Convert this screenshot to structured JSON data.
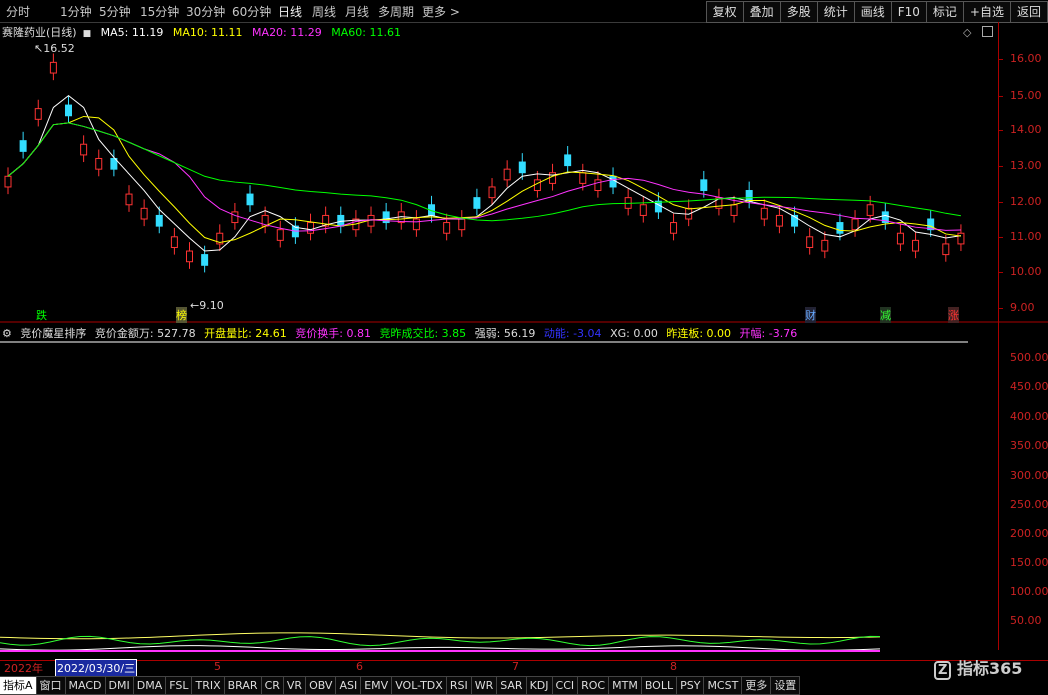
{
  "timeframes": [
    {
      "label": "分时",
      "active": false
    },
    {
      "label": "1分钟",
      "active": false
    },
    {
      "label": "5分钟",
      "active": false
    },
    {
      "label": "15分钟",
      "active": false
    },
    {
      "label": "30分钟",
      "active": false
    },
    {
      "label": "60分钟",
      "active": false
    },
    {
      "label": "日线",
      "active": true
    },
    {
      "label": "周线",
      "active": false
    },
    {
      "label": "月线",
      "active": false
    },
    {
      "label": "多周期",
      "active": false
    },
    {
      "label": "更多 >",
      "active": false
    }
  ],
  "toolbar": [
    "复权",
    "叠加",
    "多股",
    "统计",
    "画线",
    "F10",
    "标记",
    "+自选",
    "返回"
  ],
  "header": {
    "stock": "赛隆药业(日线)",
    "ma5": "MA5: 11.19",
    "ma10": "MA10: 11.11",
    "ma20": "MA20: 11.29",
    "ma60": "MA60: 11.61",
    "high_label": "16.52",
    "low_label": "9.10"
  },
  "colors": {
    "ma5": "#ffffff",
    "ma10": "#ffff00",
    "ma20": "#ff33ff",
    "ma60": "#00ff00",
    "up": "#ff3333",
    "down": "#33ddff",
    "axis": "#cc2222"
  },
  "price_axis": [
    "16.00",
    "15.00",
    "14.00",
    "13.00",
    "12.00",
    "11.00",
    "10.00",
    "9.00"
  ],
  "ind_axis": [
    "500.00",
    "450.00",
    "400.00",
    "350.00",
    "300.00",
    "250.00",
    "200.00",
    "150.00",
    "100.00",
    "50.00"
  ],
  "markers": {
    "die": "跌",
    "bang": "榜",
    "cai": "财",
    "jian": "减",
    "zhang": "涨"
  },
  "indicator": {
    "name": "竞价魔星排序",
    "amount_label": "竞价金额万: 527.78",
    "open_ratio": "开盘量比: 24.61",
    "turnover": "竞价换手: 0.81",
    "vol_ratio": "竞昨成交比: 3.85",
    "strength": "强弱: 56.19",
    "kinetic": "动能: -3.04",
    "xg": "XG: 0.00",
    "lianban": "昨连板: 0.00",
    "open_pct": "开幅: -3.76"
  },
  "dates": {
    "year": "2022年",
    "current": "2022/03/30/三",
    "m5": "5",
    "m6": "6",
    "m7": "7",
    "m8": "8"
  },
  "bottom_tabs": [
    "指标A",
    "窗口",
    "MACD",
    "DMI",
    "DMA",
    "FSL",
    "TRIX",
    "BRAR",
    "CR",
    "VR",
    "OBV",
    "ASI",
    "EMV",
    "VOL-TDX",
    "RSI",
    "WR",
    "SAR",
    "KDJ",
    "CCI",
    "ROC",
    "MTM",
    "BOLL",
    "PSY",
    "MCST",
    "更多",
    "设置"
  ],
  "logo": "指标365"
}
